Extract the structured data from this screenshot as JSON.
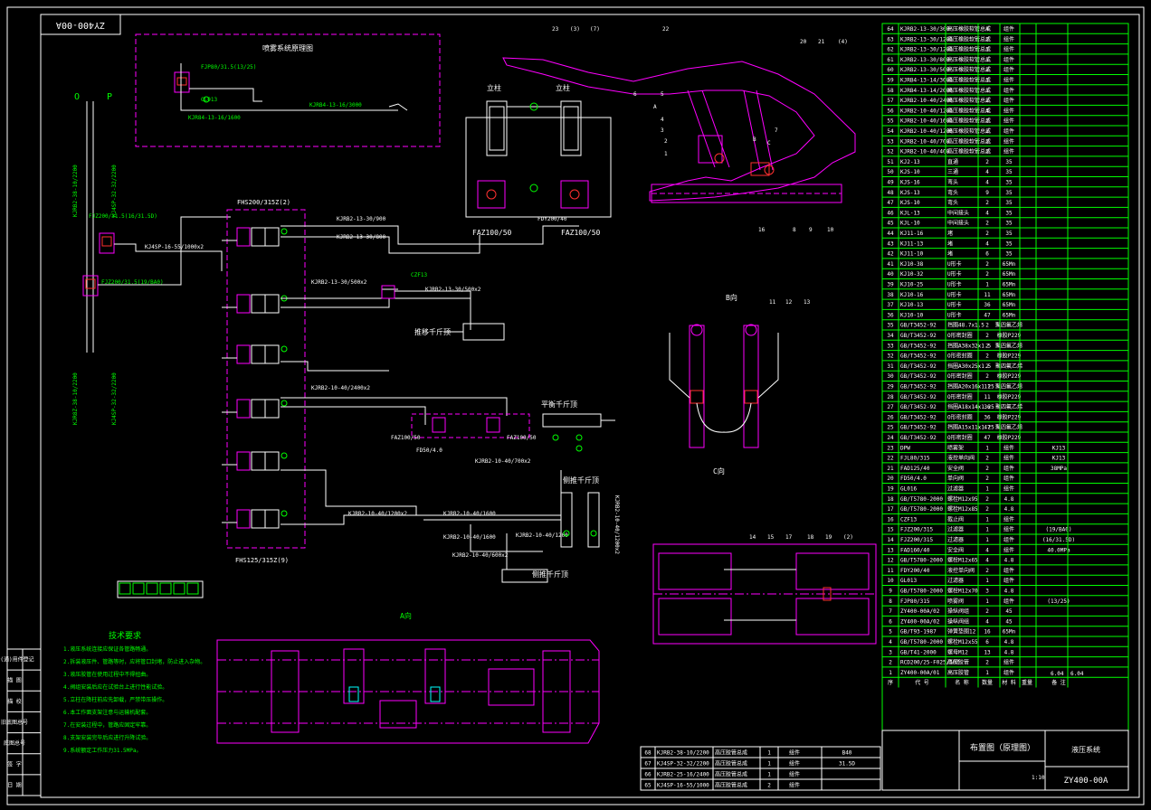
{
  "drawing": {
    "number_top": "ZY400-00A",
    "number_bottom": "ZY400-00A",
    "title": "布置图（原理图）",
    "subtitle": "液压系统",
    "scale_info": [
      "6.04",
      "6.04"
    ],
    "scale_label": "1:10"
  },
  "spray_title": "喷雾系统原理图",
  "views": {
    "a": "A向",
    "b": "B向",
    "c": "C向"
  },
  "labels": {
    "column_left": "立柱",
    "column_right": "立柱",
    "push_jack": "推移千斤顶",
    "balance_jack": "平衡千斤顶",
    "side_jack": "侧推千斤顶",
    "side_jack2": "侧推千斤顶",
    "valve_block": "FHS200/315Z(2)",
    "valve_block2": "FHS125/315Z(9)",
    "hose_o": "O",
    "hose_p": "P",
    "hose_left1": "KJRB2-38-10/2200",
    "hose_left2": "KJR8Z-38-10/2200",
    "hose_right1": "KJ4SP-32-32/2200",
    "hose_right2": "KJ4SP-32-32/2200",
    "faz_left": "FAZ100/50",
    "faz_right": "FAZ100/50",
    "faz_mid_l": "FAZ100/50",
    "faz_mid_r": "FAZ100/50",
    "fdy": "FDY200/40",
    "fd": "FD50/4.0",
    "filter": "FJZ200/31.5(16/31.5D)",
    "filter2": "FJZ200/31.5(19/BA0)",
    "spray_valve": "FJP80/31.5(13/25)",
    "glo": "GL013",
    "sprayhose": "KJRB4-13-16/3000",
    "sprayhose2": "KJR84-13-16/1600",
    "hose_a": "KJRB2-13-30/900",
    "hose_b": "KJRB2-13-30/800",
    "hose_c": "KJRB2-13-30/500x2",
    "hose_d": "KJRB2-13-30/500x2",
    "hose_e": "KJRB2-10-40/2400x2",
    "hose_f": "KJRB2-10-40/700x2",
    "hose_g": "KJRB2-10-40/1200x2",
    "hose_h": "KJRB2-10-40/1600",
    "hose_i": "KJRB2-10-40/1600",
    "hose_j": "KJRB2-10-40/600x2",
    "hose_k": "KJRB2-10-40/1200",
    "hose_l": "KJ4SP-16-55/1000x2",
    "czf": "CZF13"
  },
  "callouts": [
    "23",
    "(3)",
    "(7)",
    "22",
    "20",
    "21",
    "(4)",
    "6",
    "5",
    "A",
    "4",
    "3",
    "2",
    "1",
    "B",
    "C",
    "7",
    "16",
    "8",
    "9",
    "10",
    "11",
    "12",
    "13",
    "14",
    "15",
    "17",
    "18",
    "19",
    "(2)"
  ],
  "notes_title": "技术要求",
  "notes": [
    "1.液压系统连接应保证各管路畅通。",
    "2.拆装液压件、管路等时，应将管口封堵，防止进入杂物。",
    "3.液压胶管在使用过程中不得扭曲。",
    "4.阀组安装后应在试验台上进行性能试验。",
    "5.立柱在降柱前应先卸载，严禁带压操作。",
    "6.本工作面支架注意与运输机配套。",
    "7.在安装过程中，管路应固定牢靠。",
    "8.支架安装完毕后应进行升降试验。",
    "9.系统额定工作压力31.5MPa。"
  ],
  "left_strip": [
    "借(通)用件登记",
    "描 图",
    "描 校",
    "旧底图总号",
    "底图总号",
    "签 字",
    "日 期"
  ],
  "legend_row": [
    "",
    "",
    "",
    "",
    "",
    "",
    ""
  ],
  "bom": [
    {
      "no": "64",
      "code": "KJRB2-13-30/300",
      "name": "高压橡胶软管总成",
      "qty": "4",
      "mat": "组件",
      "note": ""
    },
    {
      "no": "63",
      "code": "KJRB2-13-30/1200",
      "name": "高压橡胶软管总成",
      "qty": "2",
      "mat": "组件",
      "note": ""
    },
    {
      "no": "62",
      "code": "KJRB2-13-30/1200",
      "name": "高压橡胶软管总成",
      "qty": "1",
      "mat": "组件",
      "note": ""
    },
    {
      "no": "61",
      "code": "KJRB2-13-30/800",
      "name": "高压橡胶软管总成",
      "qty": "1",
      "mat": "组件",
      "note": ""
    },
    {
      "no": "60",
      "code": "KJRB2-13-30/500",
      "name": "高压橡胶软管总成",
      "qty": "2",
      "mat": "组件",
      "note": ""
    },
    {
      "no": "59",
      "code": "KJRB4-13-14/3000",
      "name": "高压橡胶软管总成",
      "qty": "1",
      "mat": "组件",
      "note": ""
    },
    {
      "no": "58",
      "code": "KJRB4-13-14/2000",
      "name": "高压橡胶软管总成",
      "qty": "1",
      "mat": "组件",
      "note": ""
    },
    {
      "no": "57",
      "code": "KJRB2-10-40/2400",
      "name": "高压橡胶软管总成",
      "qty": "2",
      "mat": "组件",
      "note": ""
    },
    {
      "no": "56",
      "code": "KJRB2-10-40/1200",
      "name": "高压橡胶软管总成",
      "qty": "4",
      "mat": "组件",
      "note": ""
    },
    {
      "no": "55",
      "code": "KJRB2-10-40/1600",
      "name": "高压橡胶软管总成",
      "qty": "2",
      "mat": "组件",
      "note": ""
    },
    {
      "no": "54",
      "code": "KJRB2-10-40/1200",
      "name": "高压橡胶软管总成",
      "qty": "2",
      "mat": "组件",
      "note": ""
    },
    {
      "no": "53",
      "code": "KJRB2-10-40/700",
      "name": "高压橡胶软管总成",
      "qty": "2",
      "mat": "组件",
      "note": ""
    },
    {
      "no": "52",
      "code": "KJRB2-10-40/400",
      "name": "高压橡胶软管总成",
      "qty": "2",
      "mat": "组件",
      "note": ""
    },
    {
      "no": "51",
      "code": "KJ2-13",
      "name": "直通",
      "qty": "2",
      "mat": "35",
      "note": ""
    },
    {
      "no": "50",
      "code": "KJS-10",
      "name": "三通",
      "qty": "4",
      "mat": "35",
      "note": ""
    },
    {
      "no": "49",
      "code": "KJS-16",
      "name": "弯头",
      "qty": "4",
      "mat": "35",
      "note": ""
    },
    {
      "no": "48",
      "code": "KJS-13",
      "name": "弯头",
      "qty": "9",
      "mat": "35",
      "note": ""
    },
    {
      "no": "47",
      "code": "KJS-10",
      "name": "弯头",
      "qty": "2",
      "mat": "35",
      "note": ""
    },
    {
      "no": "46",
      "code": "KJL-13",
      "name": "中间接头",
      "qty": "4",
      "mat": "35",
      "note": ""
    },
    {
      "no": "45",
      "code": "KJL-10",
      "name": "中间接头",
      "qty": "2",
      "mat": "35",
      "note": ""
    },
    {
      "no": "44",
      "code": "KJ11-16",
      "name": "堵",
      "qty": "2",
      "mat": "35",
      "note": ""
    },
    {
      "no": "43",
      "code": "KJ11-13",
      "name": "堵",
      "qty": "4",
      "mat": "35",
      "note": ""
    },
    {
      "no": "42",
      "code": "KJ11-10",
      "name": "堵",
      "qty": "6",
      "mat": "35",
      "note": ""
    },
    {
      "no": "41",
      "code": "KJ10-38",
      "name": "U形卡",
      "qty": "2",
      "mat": "65Mn",
      "note": ""
    },
    {
      "no": "40",
      "code": "KJ10-32",
      "name": "U形卡",
      "qty": "2",
      "mat": "65Mn",
      "note": ""
    },
    {
      "no": "39",
      "code": "KJ10-25",
      "name": "U形卡",
      "qty": "1",
      "mat": "65Mn",
      "note": ""
    },
    {
      "no": "38",
      "code": "KJ10-16",
      "name": "U形卡",
      "qty": "11",
      "mat": "65Mn",
      "note": ""
    },
    {
      "no": "37",
      "code": "KJ10-13",
      "name": "U形卡",
      "qty": "36",
      "mat": "65Mn",
      "note": ""
    },
    {
      "no": "36",
      "code": "KJ10-10",
      "name": "U形卡",
      "qty": "47",
      "mat": "65Mn",
      "note": ""
    },
    {
      "no": "35",
      "code": "GB/T3452-92",
      "name": "挡圈48.7x1.5",
      "qty": "2",
      "mat": "聚四氟乙烯",
      "note": ""
    },
    {
      "no": "34",
      "code": "GB/T3452-92",
      "name": "O形密封圈",
      "qty": "2",
      "mat": "橡胶P229",
      "note": ""
    },
    {
      "no": "33",
      "code": "GB/T3452-92",
      "name": "挡圈A38x32x1.5",
      "qty": "2",
      "mat": "聚四氟乙烯",
      "note": ""
    },
    {
      "no": "32",
      "code": "GB/T3452-92",
      "name": "O形密封圈",
      "qty": "2",
      "mat": "橡胶P229",
      "note": ""
    },
    {
      "no": "31",
      "code": "GB/T3452-92",
      "name": "挡圈A30x25x1.5",
      "qty": "2",
      "mat": "聚四氟乙烯",
      "note": ""
    },
    {
      "no": "30",
      "code": "GB/T3452-92",
      "name": "O形密封圈",
      "qty": "2",
      "mat": "橡胶P229",
      "note": ""
    },
    {
      "no": "29",
      "code": "GB/T3452-92",
      "name": "挡圈A20x16x1.25",
      "qty": "11",
      "mat": "聚四氟乙烯",
      "note": ""
    },
    {
      "no": "28",
      "code": "GB/T3452-92",
      "name": "O形密封圈",
      "qty": "11",
      "mat": "橡胶P229",
      "note": ""
    },
    {
      "no": "27",
      "code": "GB/T3452-92",
      "name": "挡圈A18x14x1.25",
      "qty": "36",
      "mat": "聚四氟乙烯",
      "note": ""
    },
    {
      "no": "26",
      "code": "GB/T3452-92",
      "name": "O形密封圈",
      "qty": "36",
      "mat": "橡胶P229",
      "note": ""
    },
    {
      "no": "25",
      "code": "GB/T3452-92",
      "name": "挡圈A15x11x1.25",
      "qty": "47",
      "mat": "聚四氟乙烯",
      "note": ""
    },
    {
      "no": "24",
      "code": "GB/T3452-92",
      "name": "O形密封圈",
      "qty": "47",
      "mat": "橡胶P229",
      "note": ""
    },
    {
      "no": "23",
      "code": "DPW",
      "name": "喷雾架",
      "qty": "1",
      "mat": "组件",
      "note": "KJ13"
    },
    {
      "no": "22",
      "code": "FJL80/315",
      "name": "液控单向阀",
      "qty": "2",
      "mat": "组件",
      "note": "KJ13"
    },
    {
      "no": "21",
      "code": "FAD125/40",
      "name": "安全阀",
      "qty": "2",
      "mat": "组件",
      "note": "38MPa"
    },
    {
      "no": "20",
      "code": "FD50/4.0",
      "name": "单向阀",
      "qty": "2",
      "mat": "组件",
      "note": ""
    },
    {
      "no": "19",
      "code": "GL016",
      "name": "过滤器",
      "qty": "1",
      "mat": "组件",
      "note": ""
    },
    {
      "no": "18",
      "code": "GB/T5780-2000",
      "name": "螺栓M12x95",
      "qty": "2",
      "mat": "4.8",
      "note": ""
    },
    {
      "no": "17",
      "code": "GB/T5780-2000",
      "name": "螺栓M12x85",
      "qty": "2",
      "mat": "4.8",
      "note": ""
    },
    {
      "no": "16",
      "code": "CZF13",
      "name": "截止阀",
      "qty": "1",
      "mat": "组件",
      "note": ""
    },
    {
      "no": "15",
      "code": "FJZ200/315",
      "name": "过滤器",
      "qty": "1",
      "mat": "组件",
      "note": "(19/BA0)"
    },
    {
      "no": "14",
      "code": "FJZ200/315",
      "name": "过滤器",
      "qty": "1",
      "mat": "组件",
      "note": "(16/31.5D)"
    },
    {
      "no": "13",
      "code": "FAD160/40",
      "name": "安全阀",
      "qty": "4",
      "mat": "组件",
      "note": "40.0MPa"
    },
    {
      "no": "12",
      "code": "GB/T5780-2000",
      "name": "螺栓M12x65",
      "qty": "4",
      "mat": "4.8",
      "note": ""
    },
    {
      "no": "11",
      "code": "FDY200/40",
      "name": "液控单向阀",
      "qty": "2",
      "mat": "组件",
      "note": ""
    },
    {
      "no": "10",
      "code": "GL013",
      "name": "过滤器",
      "qty": "1",
      "mat": "组件",
      "note": ""
    },
    {
      "no": "9",
      "code": "GB/T5780-2000",
      "name": "螺栓M12x70",
      "qty": "3",
      "mat": "4.8",
      "note": ""
    },
    {
      "no": "8",
      "code": "FJP80/315",
      "name": "喷雾阀",
      "qty": "1",
      "mat": "组件",
      "note": "(13/25)"
    },
    {
      "no": "7",
      "code": "ZY400-00A/02",
      "name": "操纵阀组",
      "qty": "2",
      "mat": "45",
      "note": ""
    },
    {
      "no": "6",
      "code": "ZY400-00A/02",
      "name": "操纵阀组",
      "qty": "4",
      "mat": "45",
      "note": ""
    },
    {
      "no": "5",
      "code": "GB/T93-1987",
      "name": "弹簧垫圈12",
      "qty": "16",
      "mat": "65Mn",
      "note": ""
    },
    {
      "no": "4",
      "code": "GB/T5780-2000",
      "name": "螺栓M12x55",
      "qty": "6",
      "mat": "4.8",
      "note": ""
    },
    {
      "no": "3",
      "code": "GB/T41-2000",
      "name": "螺母M12",
      "qty": "13",
      "mat": "4.8",
      "note": ""
    },
    {
      "no": "2",
      "code": "RCD200/25-F025/50Z",
      "name": "高压胶管",
      "qty": "2",
      "mat": "组件",
      "note": ""
    },
    {
      "no": "1",
      "code": "ZY400-00A/01",
      "name": "高压胶管",
      "qty": "1",
      "mat": "组件",
      "note": ""
    }
  ],
  "bom_header": [
    "序",
    "代 号",
    "名 称",
    "数量",
    "材 料",
    "重量",
    "备 注"
  ],
  "bom_bottom": [
    {
      "no": "68",
      "code": "KJRB2-38-10/2200",
      "name": "高压胶管总成",
      "qty": "1",
      "mat": "组件",
      "note": "B40"
    },
    {
      "no": "67",
      "code": "KJ4SP-32-32/2200",
      "name": "高压胶管总成",
      "qty": "1",
      "mat": "组件",
      "note": "31.5D"
    },
    {
      "no": "66",
      "code": "KJRB2-25-16/2400",
      "name": "高压胶管总成",
      "qty": "1",
      "mat": "组件",
      "note": ""
    },
    {
      "no": "65",
      "code": "KJ4SP-16-55/1000",
      "name": "高压胶管总成",
      "qty": "2",
      "mat": "组件",
      "note": ""
    }
  ]
}
